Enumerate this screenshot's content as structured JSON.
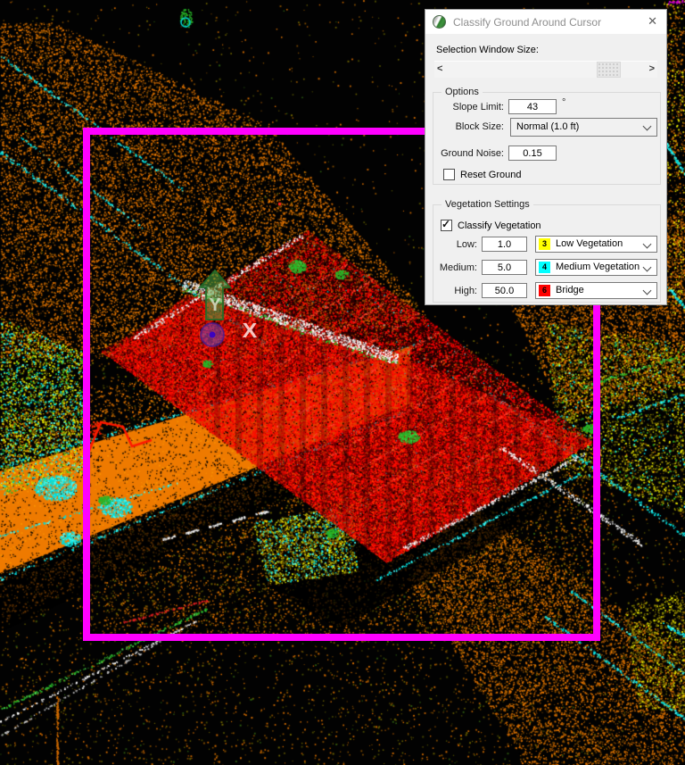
{
  "dialog": {
    "title": "Classify Ground Around Cursor",
    "close_glyph": "✕",
    "check_glyph": "✓",
    "selection_window": {
      "label": "Selection Window Size:",
      "arrow_left": "<",
      "arrow_right": ">"
    },
    "options": {
      "group_label": "Options",
      "slope_limit": {
        "label": "Slope Limit:",
        "value": "43",
        "unit": "°"
      },
      "block_size": {
        "label": "Block Size:",
        "value": "Normal (1.0 ft)"
      },
      "ground_noise": {
        "label": "Ground Noise:",
        "value": "0.15"
      },
      "reset_ground": {
        "label": "Reset Ground",
        "checked": false
      }
    },
    "vegetation": {
      "group_label": "Vegetation Settings",
      "classify": {
        "label": "Classify Vegetation",
        "checked": true
      },
      "rows": [
        {
          "label": "Low:",
          "value": "1.0",
          "class_number": "3",
          "class_name": "Low Vegetation",
          "swatch_color": "#ffff00"
        },
        {
          "label": "Medium:",
          "value": "5.0",
          "class_number": "4",
          "class_name": "Medium Vegetation",
          "swatch_color": "#00ffff"
        },
        {
          "label": "High:",
          "value": "50.0",
          "class_number": "6",
          "class_name": "Bridge",
          "swatch_color": "#ff0000"
        }
      ]
    }
  },
  "viewport": {
    "axis_labels": {
      "y": "Y",
      "x": "X"
    },
    "colors": {
      "background": "#020202",
      "ground_orange": "#ee7a00",
      "noise_orange": "#cf6a00",
      "dark_orange": "#7e4a00",
      "olive": "#6e6400",
      "low_veg_yellow": "#e8e800",
      "medium_veg_cyan": "#00dcdc",
      "green": "#28b428",
      "bridge_red": "#ff0000",
      "white_points": "#ffffff",
      "selection_magenta": "#ff00ff",
      "axis_purple": "#7a50c8"
    }
  }
}
